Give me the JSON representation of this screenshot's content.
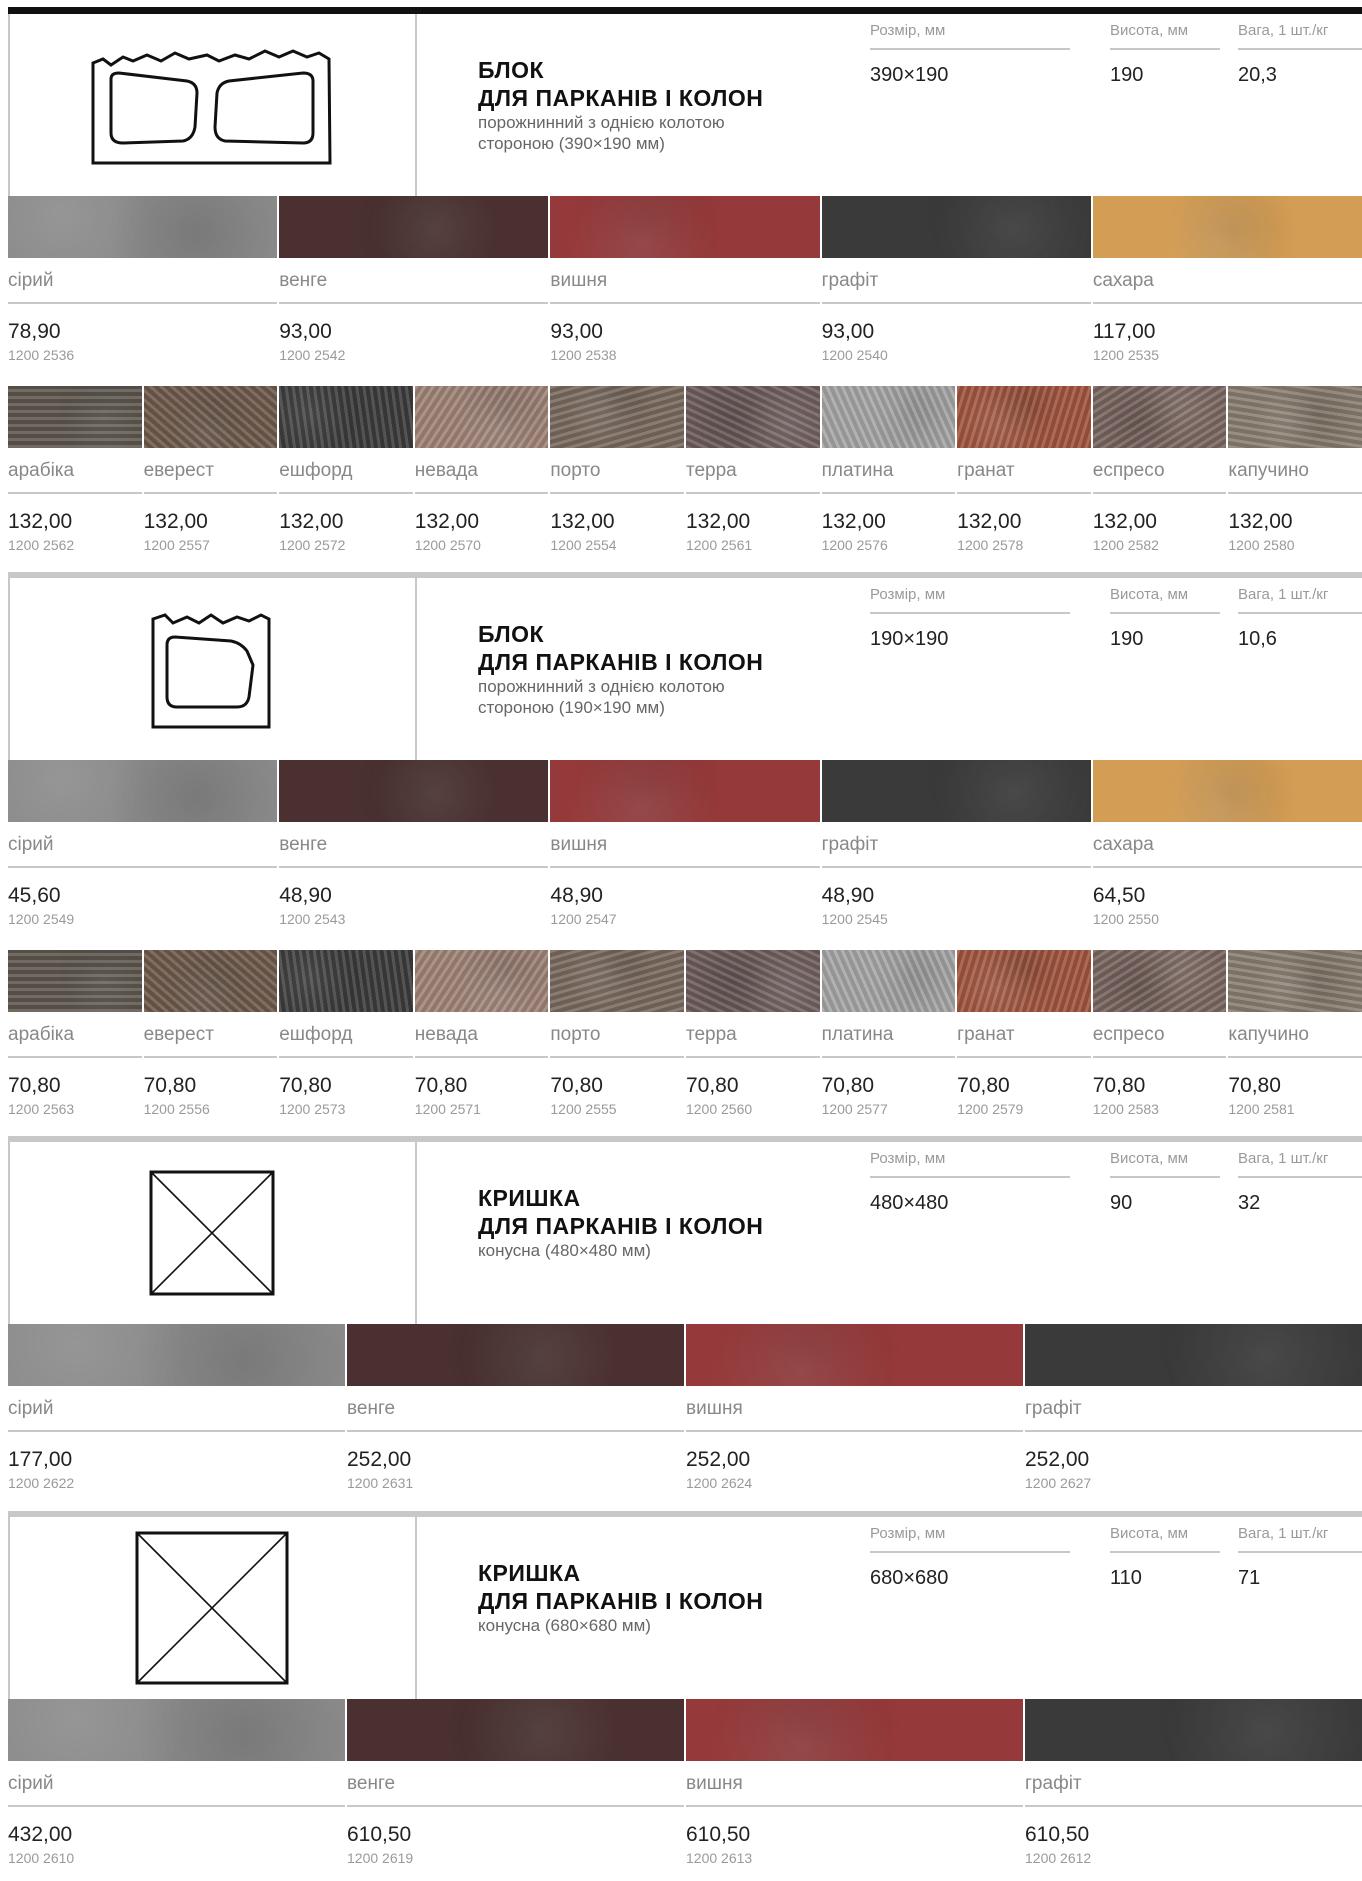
{
  "products": [
    {
      "title_line1": "БЛОК",
      "title_line2": "ДЛЯ ПАРКАНІВ І КОЛОН",
      "subtitle_line1": "порожнинний з однією колотою",
      "subtitle_line2": "стороною (390×190 мм)",
      "drawing": "double-hollow-block-icon",
      "spec_labels": {
        "size": "Розмір, мм",
        "height": "Висота, мм",
        "weight": "Вага, 1 шт./кг"
      },
      "spec_values": {
        "size": "390×190",
        "height": "190",
        "weight": "20,3"
      },
      "solid": [
        {
          "name": "сірий",
          "price": "78,90",
          "code": "1200 2536",
          "color": "#8a8a8a"
        },
        {
          "name": "венге",
          "price": "93,00",
          "code": "1200 2542",
          "color": "#4a3030"
        },
        {
          "name": "вишня",
          "price": "93,00",
          "code": "1200 2538",
          "color": "#96393a"
        },
        {
          "name": "графіт",
          "price": "93,00",
          "code": "1200 2540",
          "color": "#3a3a3a"
        },
        {
          "name": "сахара",
          "price": "117,00",
          "code": "1200 2535",
          "color": "#d39d55"
        }
      ],
      "mixed": [
        {
          "name": "арабіка",
          "price": "132,00",
          "code": "1200 2562",
          "color": "#5e574f"
        },
        {
          "name": "еверест",
          "price": "132,00",
          "code": "1200 2557",
          "color": "#6e5a4c"
        },
        {
          "name": "ешфорд",
          "price": "132,00",
          "code": "1200 2572",
          "color": "#3c3c3c"
        },
        {
          "name": "невада",
          "price": "132,00",
          "code": "1200 2570",
          "color": "#a08478"
        },
        {
          "name": "порто",
          "price": "132,00",
          "code": "1200 2554",
          "color": "#7a6a5e"
        },
        {
          "name": "терра",
          "price": "132,00",
          "code": "1200 2561",
          "color": "#6e5c5c"
        },
        {
          "name": "платина",
          "price": "132,00",
          "code": "1200 2576",
          "color": "#a6a6a6"
        },
        {
          "name": "гранат",
          "price": "132,00",
          "code": "1200 2578",
          "color": "#a0553e"
        },
        {
          "name": "еспресо",
          "price": "132,00",
          "code": "1200 2582",
          "color": "#7a6660"
        },
        {
          "name": "капучино",
          "price": "132,00",
          "code": "1200 2580",
          "color": "#8a7e70"
        }
      ]
    },
    {
      "title_line1": "БЛОК",
      "title_line2": "ДЛЯ ПАРКАНІВ І КОЛОН",
      "subtitle_line1": "порожнинний з однією колотою",
      "subtitle_line2": "стороною (190×190 мм)",
      "drawing": "single-hollow-block-icon",
      "spec_labels": {
        "size": "Розмір, мм",
        "height": "Висота, мм",
        "weight": "Вага, 1 шт./кг"
      },
      "spec_values": {
        "size": "190×190",
        "height": "190",
        "weight": "10,6"
      },
      "solid": [
        {
          "name": "сірий",
          "price": "45,60",
          "code": "1200 2549",
          "color": "#8a8a8a"
        },
        {
          "name": "венге",
          "price": "48,90",
          "code": "1200 2543",
          "color": "#4a3030"
        },
        {
          "name": "вишня",
          "price": "48,90",
          "code": "1200 2547",
          "color": "#96393a"
        },
        {
          "name": "графіт",
          "price": "48,90",
          "code": "1200 2545",
          "color": "#3a3a3a"
        },
        {
          "name": "сахара",
          "price": "64,50",
          "code": "1200 2550",
          "color": "#d39d55"
        }
      ],
      "mixed": [
        {
          "name": "арабіка",
          "price": "70,80",
          "code": "1200 2563",
          "color": "#5e574f"
        },
        {
          "name": "еверест",
          "price": "70,80",
          "code": "1200 2556",
          "color": "#6e5a4c"
        },
        {
          "name": "ешфорд",
          "price": "70,80",
          "code": "1200 2573",
          "color": "#3c3c3c"
        },
        {
          "name": "невада",
          "price": "70,80",
          "code": "1200 2571",
          "color": "#a08478"
        },
        {
          "name": "порто",
          "price": "70,80",
          "code": "1200 2555",
          "color": "#7a6a5e"
        },
        {
          "name": "терра",
          "price": "70,80",
          "code": "1200 2560",
          "color": "#6e5c5c"
        },
        {
          "name": "платина",
          "price": "70,80",
          "code": "1200 2577",
          "color": "#a6a6a6"
        },
        {
          "name": "гранат",
          "price": "70,80",
          "code": "1200 2579",
          "color": "#a0553e"
        },
        {
          "name": "еспресо",
          "price": "70,80",
          "code": "1200 2583",
          "color": "#7a6660"
        },
        {
          "name": "капучино",
          "price": "70,80",
          "code": "1200 2581",
          "color": "#8a7e70"
        }
      ]
    },
    {
      "title_line1": "КРИШКА",
      "title_line2": "ДЛЯ ПАРКАНІВ І КОЛОН",
      "subtitle_line1": "конусна (480×480 мм)",
      "subtitle_line2": "",
      "drawing": "cap-small-icon",
      "spec_labels": {
        "size": "Розмір, мм",
        "height": "Висота, мм",
        "weight": "Вага, 1 шт./кг"
      },
      "spec_values": {
        "size": "480×480",
        "height": "90",
        "weight": "32"
      },
      "solid": [
        {
          "name": "сірий",
          "price": "177,00",
          "code": "1200 2622",
          "color": "#8a8a8a"
        },
        {
          "name": "венге",
          "price": "252,00",
          "code": "1200 2631",
          "color": "#4a3030"
        },
        {
          "name": "вишня",
          "price": "252,00",
          "code": "1200 2624",
          "color": "#96393a"
        },
        {
          "name": "графіт",
          "price": "252,00",
          "code": "1200 2627",
          "color": "#3a3a3a"
        }
      ],
      "mixed": []
    },
    {
      "title_line1": "КРИШКА",
      "title_line2": "ДЛЯ ПАРКАНІВ І КОЛОН",
      "subtitle_line1": "конусна (680×680 мм)",
      "subtitle_line2": "",
      "drawing": "cap-large-icon",
      "spec_labels": {
        "size": "Розмір, мм",
        "height": "Висота, мм",
        "weight": "Вага, 1 шт./кг"
      },
      "spec_values": {
        "size": "680×680",
        "height": "110",
        "weight": "71"
      },
      "solid": [
        {
          "name": "сірий",
          "price": "432,00",
          "code": "1200 2610",
          "color": "#8a8a8a"
        },
        {
          "name": "венге",
          "price": "610,50",
          "code": "1200 2619",
          "color": "#4a3030"
        },
        {
          "name": "вишня",
          "price": "610,50",
          "code": "1200 2613",
          "color": "#96393a"
        },
        {
          "name": "графіт",
          "price": "610,50",
          "code": "1200 2612",
          "color": "#3a3a3a"
        }
      ],
      "mixed": []
    }
  ]
}
